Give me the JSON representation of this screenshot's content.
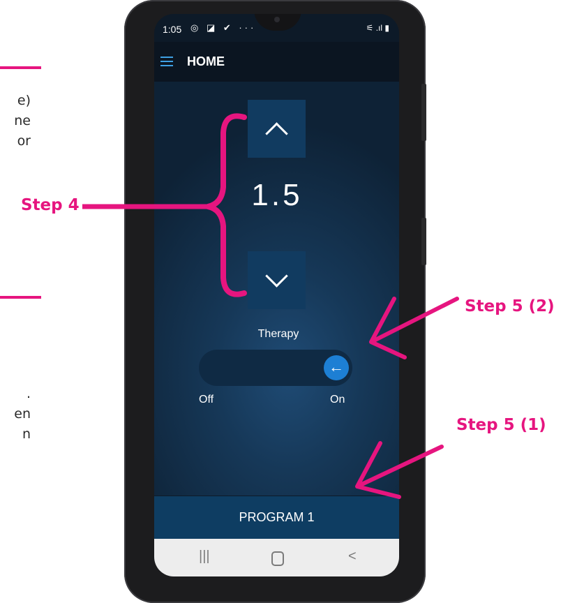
{
  "left_notes": {
    "top_lines": [
      "e)",
      "ne",
      "or"
    ],
    "bottom_lines": [
      ".",
      "en",
      "n"
    ]
  },
  "callouts": {
    "step4": "Step 4",
    "step5_2": "Step 5 (2)",
    "step5_1": "Step 5 (1)"
  },
  "status_bar": {
    "time": "1:05",
    "icons": [
      "whatsapp-icon",
      "screenshot-icon",
      "check-icon",
      "more-icon"
    ],
    "icons_text": "◎ ◪ ✔ ···",
    "right_icons_text": "⚟ .ıl ▮"
  },
  "appbar": {
    "title": "HOME"
  },
  "control": {
    "value": "1.5",
    "therapy_label": "Therapy",
    "toggle_state": "On",
    "off_label": "Off",
    "on_label": "On"
  },
  "program_button": {
    "label": "PROGRAM 1"
  },
  "navbar": {
    "recent": "|||",
    "back": "<"
  },
  "colors": {
    "accent_pink": "#e6157f",
    "button_blue": "#113b60",
    "toggle_knob": "#1d7fd4",
    "menu_blue": "#3ea0e4"
  }
}
